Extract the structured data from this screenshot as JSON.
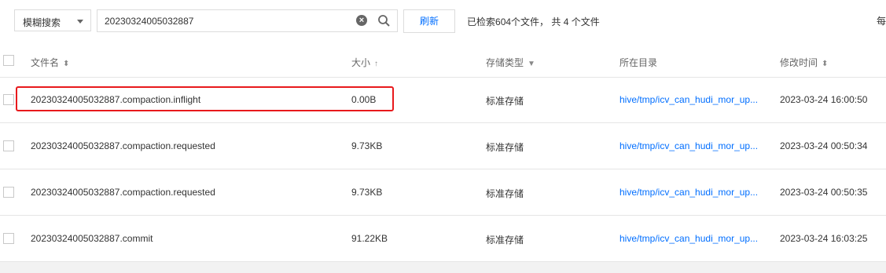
{
  "toolbar": {
    "search_mode": "模糊搜索",
    "search_value": "20230324005032887",
    "refresh_label": "刷新",
    "summary_prefix": "已检索",
    "summary_searched": "604",
    "summary_mid": "个文件，  共 ",
    "summary_count": "4",
    "summary_suffix": " 个文件",
    "right_clipped": "每"
  },
  "table": {
    "columns": [
      {
        "label": "文件名",
        "sort_icon": "sort-both-icon"
      },
      {
        "label": "大小",
        "sort_icon": "sort-up-icon"
      },
      {
        "label": "存储类型",
        "sort_icon": "filter-icon"
      },
      {
        "label": "所在目录",
        "sort_icon": ""
      },
      {
        "label": "修改时间",
        "sort_icon": "sort-both-icon"
      }
    ],
    "rows": [
      {
        "name": "20230324005032887.compaction.inflight",
        "size": "0.00B",
        "storage": "标准存储",
        "dir": "hive/tmp/icv_can_hudi_mor_up...",
        "modified": "2023-03-24 16:00:50"
      },
      {
        "name": "20230324005032887.compaction.requested",
        "size": "9.73KB",
        "storage": "标准存储",
        "dir": "hive/tmp/icv_can_hudi_mor_up...",
        "modified": "2023-03-24 00:50:34"
      },
      {
        "name": "20230324005032887.compaction.requested",
        "size": "9.73KB",
        "storage": "标准存储",
        "dir": "hive/tmp/icv_can_hudi_mor_up...",
        "modified": "2023-03-24 00:50:35"
      },
      {
        "name": "20230324005032887.commit",
        "size": "91.22KB",
        "storage": "标准存储",
        "dir": "hive/tmp/icv_can_hudi_mor_up...",
        "modified": "2023-03-24 16:03:25"
      }
    ]
  },
  "colors": {
    "link": "#006eff",
    "highlight": "#e8191c",
    "border": "#e5e5e5"
  }
}
